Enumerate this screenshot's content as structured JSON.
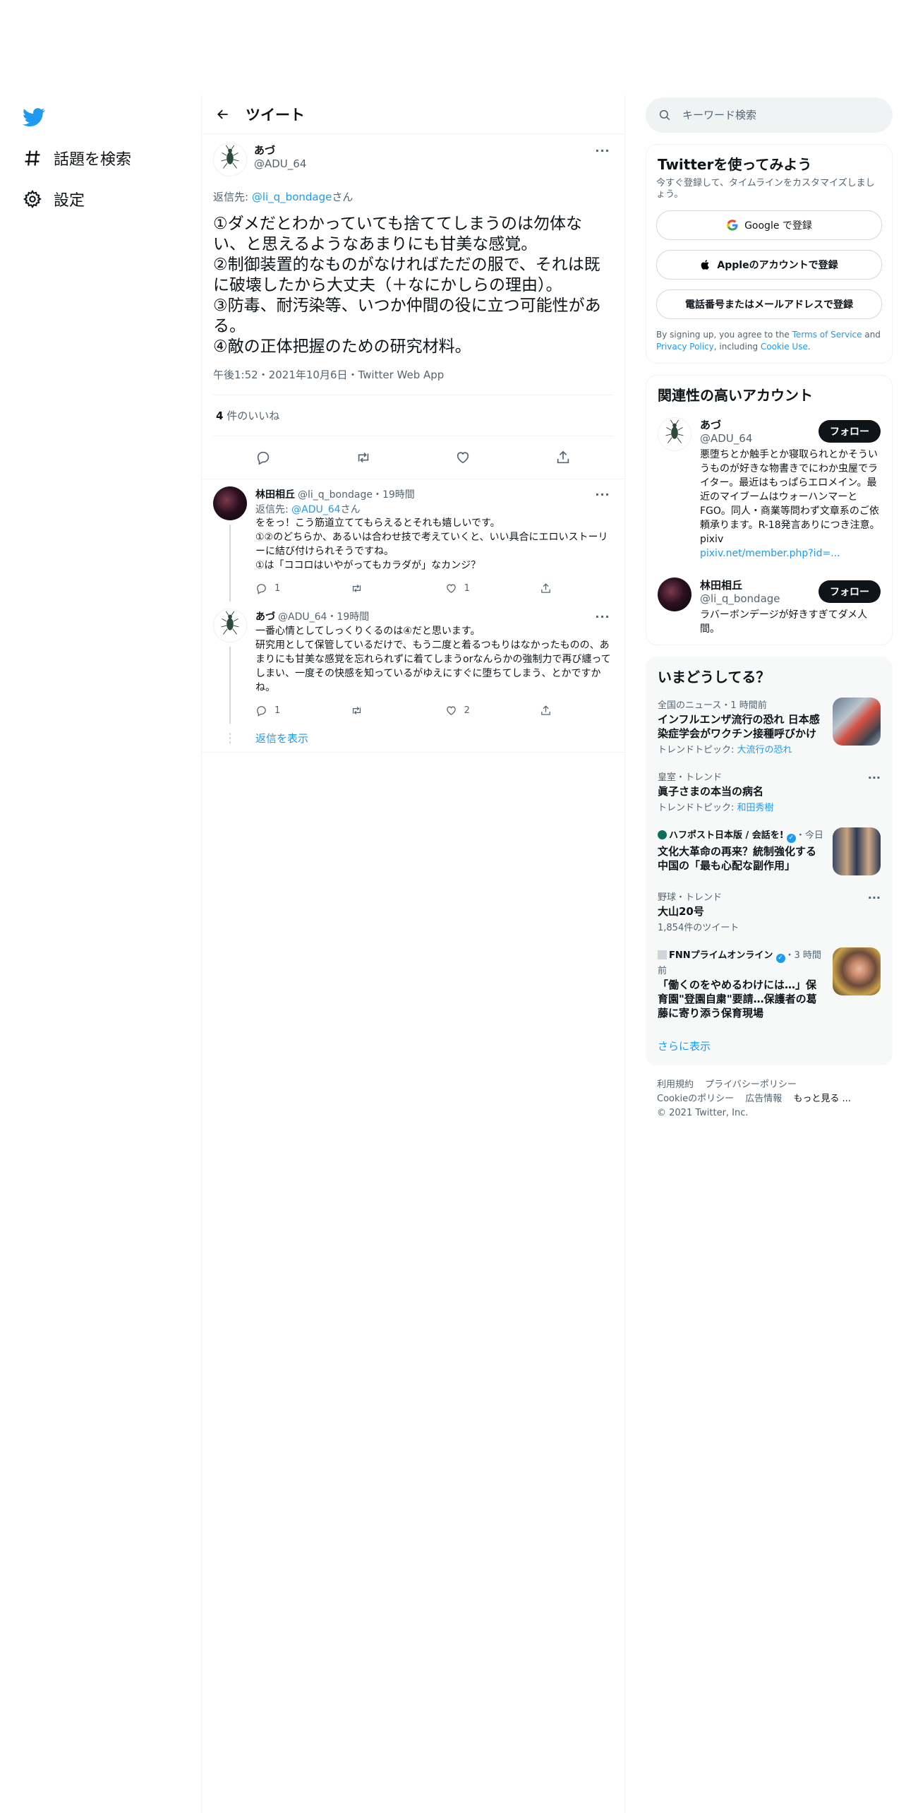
{
  "nav": {
    "explore_label": "話題を検索",
    "settings_label": "設定"
  },
  "header": {
    "title": "ツイート"
  },
  "tweet": {
    "author_name": "あづ",
    "author_handle": "@ADU_64",
    "reply_to_prefix": "返信先: ",
    "reply_to_handle": "@li_q_bondage",
    "reply_to_suffix": "さん",
    "body": "①ダメだとわかっていても捨ててしまうのは勿体ない、と思えるようなあまりにも甘美な感覚。\n②制御装置的なものがなければただの服で、それは既に破壊したから大丈夫（＋なにかしらの理由）。\n③防毒、耐汚染等、いつか仲間の役に立つ可能性がある。\n④敵の正体把握のための研究材料。",
    "timestamp": "午後1:52・2021年10月6日・Twitter Web App",
    "likes_count": "4",
    "likes_label": " 件のいいね"
  },
  "replies": [
    {
      "name": "林田相丘",
      "meta": "@li_q_bondage・19時間",
      "reply_to_prefix": "返信先: ",
      "reply_to_handle": "@ADU_64",
      "reply_to_suffix": "さん",
      "text": "ををっ！こう筋道立ててもらえるとそれも嬉しいです。\n①②のどちらか、あるいは合わせ技で考えていくと、いい具合にエロいストーリーに結び付けられそうですね。\n①は「ココロはいやがってもカラダが」なカンジ？",
      "reply_count": "1",
      "retweet_count": "",
      "like_count": "1"
    },
    {
      "name": "あづ",
      "meta": "@ADU_64・19時間",
      "text": "一番心情としてしっくりくるのは④だと思います。\n研究用として保管しているだけで、もう二度と着るつもりはなかったものの、あまりにも甘美な感覚を忘れられずに着てしまうorなんらかの強制力で再び纏ってしまい、一度その快感を知っているがゆえにすぐに堕ちてしまう、とかですかね。",
      "reply_count": "1",
      "retweet_count": "",
      "like_count": "2"
    }
  ],
  "show_replies_label": "返信を表示",
  "search": {
    "placeholder": "キーワード検索"
  },
  "signup": {
    "title": "Twitterを使ってみよう",
    "subtitle": "今すぐ登録して、タイムラインをカスタマイズしましょう。",
    "google_label": "Google で登録",
    "apple_label": "Appleのアカウントで登録",
    "phone_label": "電話番号またはメールアドレスで登録",
    "legal_prefix": "By signing up, you agree to the ",
    "terms_link": "Terms of Service",
    "legal_and": " and ",
    "privacy_link": "Privacy Policy",
    "legal_including": ", including ",
    "cookie_link": "Cookie Use",
    "legal_end": "."
  },
  "relevant": {
    "title": "関連性の高いアカウント",
    "follow_label": "フォロー",
    "accounts": [
      {
        "name": "あづ",
        "handle": "@ADU_64",
        "bio": "悪堕ちとか触手とか寝取られとかそういうものが好きな物書きでにわか虫屋でライター。最近はもっぱらエロメイン。最近のマイブームはウォーハンマーとFGO。同人・商業等問わず文章系のご依頼承ります。R-18発言ありにつき注意。pixiv",
        "link": "pixiv.net/member.php?id=..."
      },
      {
        "name": "林田相丘",
        "handle": "@li_q_bondage",
        "bio": "ラバーボンデージが好きすぎてダメ人間。",
        "link": ""
      }
    ]
  },
  "trends": {
    "title": "いまどうしてる？",
    "items": [
      {
        "context": "全国のニュース・1 時間前",
        "title": "インフルエンザ流行の恐れ 日本感染症学会がワクチン接種呼びかけ",
        "sub_prefix": "トレンドトピック: ",
        "sub_link": "大流行の恐れ"
      },
      {
        "context": "皇室・トレンド",
        "title": "眞子さまの本当の病名",
        "sub_prefix": "トレンドトピック: ",
        "sub_link": "和田秀樹"
      },
      {
        "context": "ハフポスト日本版 / 会話を!",
        "context_time": "・今日",
        "title": "文化大革命の再来？統制強化する中国の「最も心配な副作用」",
        "sub_prefix": "",
        "sub_link": ""
      },
      {
        "context": "野球・トレンド",
        "title": "大山20号",
        "sub_prefix": "1,854件のツイート",
        "sub_link": ""
      },
      {
        "context": "FNNプライムオンライン",
        "context_time": "・3 時間前",
        "title": "「働くのをやめるわけには…」保育園\"登園自粛\"要請…保護者の葛藤に寄り添う保育現場",
        "sub_prefix": "",
        "sub_link": ""
      }
    ],
    "show_more": "さらに表示"
  },
  "footer": {
    "terms": "利用規約",
    "privacy": "プライバシーポリシー",
    "cookie": "Cookieのポリシー",
    "ads": "広告情報",
    "more": "もっと見る ...",
    "copyright": "© 2021 Twitter, Inc."
  },
  "colors": {
    "accent": "#1d9bf0",
    "text": "#0f1419",
    "muted": "#536471",
    "border": "#eff3f4"
  }
}
